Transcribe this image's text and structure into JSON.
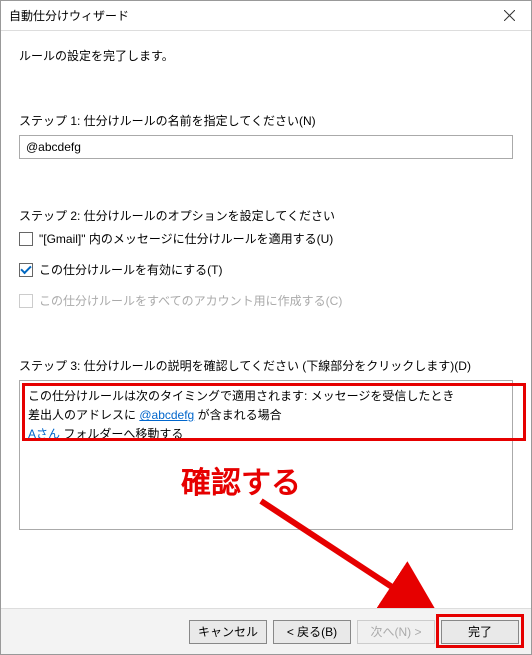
{
  "window": {
    "title": "自動仕分けウィザード"
  },
  "intro": "ルールの設定を完了します。",
  "step1": {
    "label": "ステップ 1: 仕分けルールの名前を指定してください(N)",
    "value": "@abcdefg"
  },
  "step2": {
    "label": "ステップ 2: 仕分けルールのオプションを設定してください",
    "opt_apply_gmail": {
      "label": "\"[Gmail]\" 内のメッセージに仕分けルールを適用する(U)",
      "checked": false
    },
    "opt_enable_rule": {
      "label": "この仕分けルールを有効にする(T)",
      "checked": true
    },
    "opt_all_accounts": {
      "label": "この仕分けルールをすべてのアカウント用に作成する(C)",
      "checked": false,
      "disabled": true
    }
  },
  "step3": {
    "label": "ステップ 3: 仕分けルールの説明を確認してください (下線部分をクリックします)(D)",
    "line1_prefix": "この仕分けルールは次のタイミングで適用されます: メッセージを受信したとき",
    "line2_prefix": "差出人のアドレスに ",
    "line2_link": "@abcdefg",
    "line2_suffix": " が含まれる場合",
    "line3_link": "Aさん",
    "line3_suffix": " フォルダーへ移動する"
  },
  "annotation": {
    "confirm": "確認する"
  },
  "buttons": {
    "cancel": "キャンセル",
    "back": "< 戻る(B)",
    "next": "次へ(N) >",
    "finish": "完了"
  }
}
